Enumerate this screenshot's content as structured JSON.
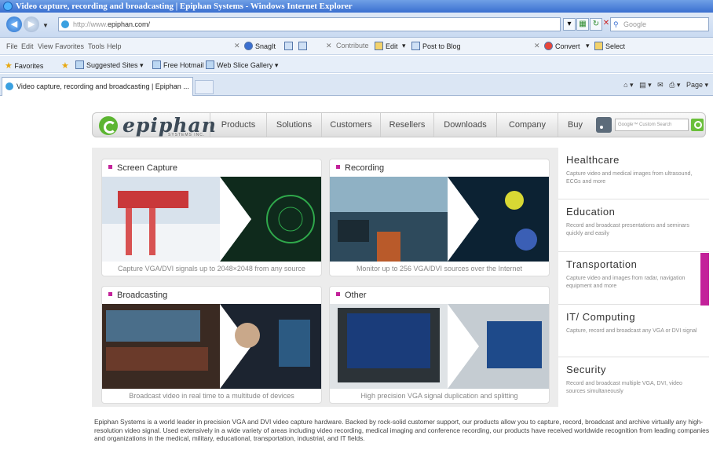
{
  "window": {
    "title": "Video capture, recording and broadcasting | Epiphan Systems - Windows Internet Explorer"
  },
  "address": {
    "protocol": "http://www.",
    "domain": "epiphan.com/"
  },
  "search": {
    "placeholder": "Google"
  },
  "menu": {
    "items": [
      "File",
      "Edit",
      "View",
      "Favorites",
      "Tools",
      "Help"
    ]
  },
  "toolbar": {
    "snagit": "SnagIt",
    "contribute": "Contribute",
    "edit": "Edit",
    "post_to_blog": "Post to Blog",
    "convert": "Convert",
    "select": "Select"
  },
  "favorites": {
    "label": "Favorites",
    "items": [
      "Suggested Sites ▾",
      "Free Hotmail",
      "Web Slice Gallery ▾"
    ]
  },
  "tab": {
    "title": "Video capture, recording and broadcasting | Epiphan ..."
  },
  "command_bar": {
    "page_label": "Page ▾"
  },
  "site": {
    "logo": "epiphan",
    "logo_sub": "SYSTEMS INC.",
    "nav": [
      "Products",
      "Solutions",
      "Customers",
      "Resellers",
      "Downloads",
      "Company",
      "Buy"
    ],
    "search_placeholder": "Google™ Custom Search"
  },
  "cards": [
    {
      "title": "Screen Capture",
      "caption": "Capture VGA/DVI signals up to 2048×2048 from any source"
    },
    {
      "title": "Recording",
      "caption": "Monitor up to 256 VGA/DVI sources over the Internet"
    },
    {
      "title": "Broadcasting",
      "caption": "Broadcast video in real time to a multitude of devices"
    },
    {
      "title": "Other",
      "caption": "High precision VGA signal duplication and splitting"
    }
  ],
  "sectors": [
    {
      "title": "Healthcare",
      "desc": "Capture video and medical images from ultrasound, ECGs and more"
    },
    {
      "title": "Education",
      "desc": "Record and broadcast presentations and seminars quickly and easily"
    },
    {
      "title": "Transportation",
      "desc": "Capture video and images from radar, navigation equipment and more"
    },
    {
      "title": "IT/ Computing",
      "desc": "Capture, record and broadcast any VGA or DVI signal"
    },
    {
      "title": "Security",
      "desc": "Record and broadcast multiple VGA, DVI, video sources simultaneously"
    }
  ],
  "colors": {
    "accent": "#c3229a",
    "brand_green": "#5cb531",
    "ie_blue": "#3a6fd0"
  },
  "about": "Epiphan Systems is a world leader in precision VGA and DVI video capture hardware. Backed by rock-solid customer support, our products allow you to capture, record, broadcast and archive virtually any high-resolution video signal. Used extensively in a wide variety of areas including video recording, medical imaging and conference recording, our products have received worldwide recognition from leading companies and organizations in the medical, military, educational, transportation, industrial, and IT fields."
}
